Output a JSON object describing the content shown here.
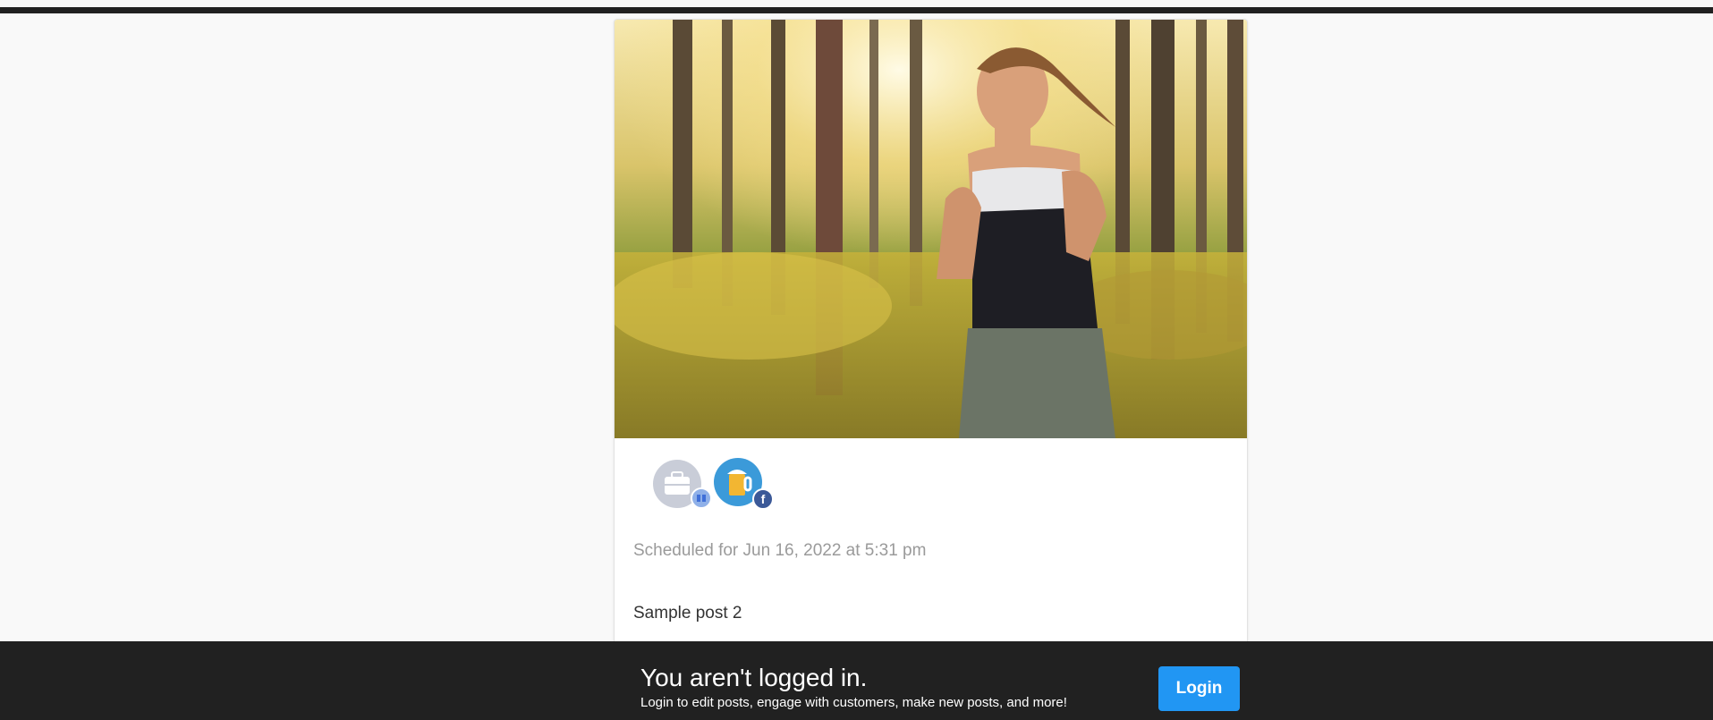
{
  "post": {
    "scheduled_text": "Scheduled for Jun 16, 2022 at 5:31 pm",
    "body_text": "Sample post 2",
    "image_description_icon": "runner-photo",
    "accounts": [
      {
        "avatar_icon": "briefcase-icon",
        "network_icon": "google-my-business-icon"
      },
      {
        "avatar_icon": "beer-mug-icon",
        "network_icon": "facebook-icon"
      }
    ]
  },
  "login_banner": {
    "title": "You aren't logged in.",
    "subtitle": "Login to edit posts, engage with customers, make new posts, and more!",
    "button_label": "Login"
  },
  "colors": {
    "accent": "#2196f3",
    "banner_bg": "#212121",
    "page_bg": "#f9f9f9",
    "muted_text": "#9a9a9a"
  }
}
